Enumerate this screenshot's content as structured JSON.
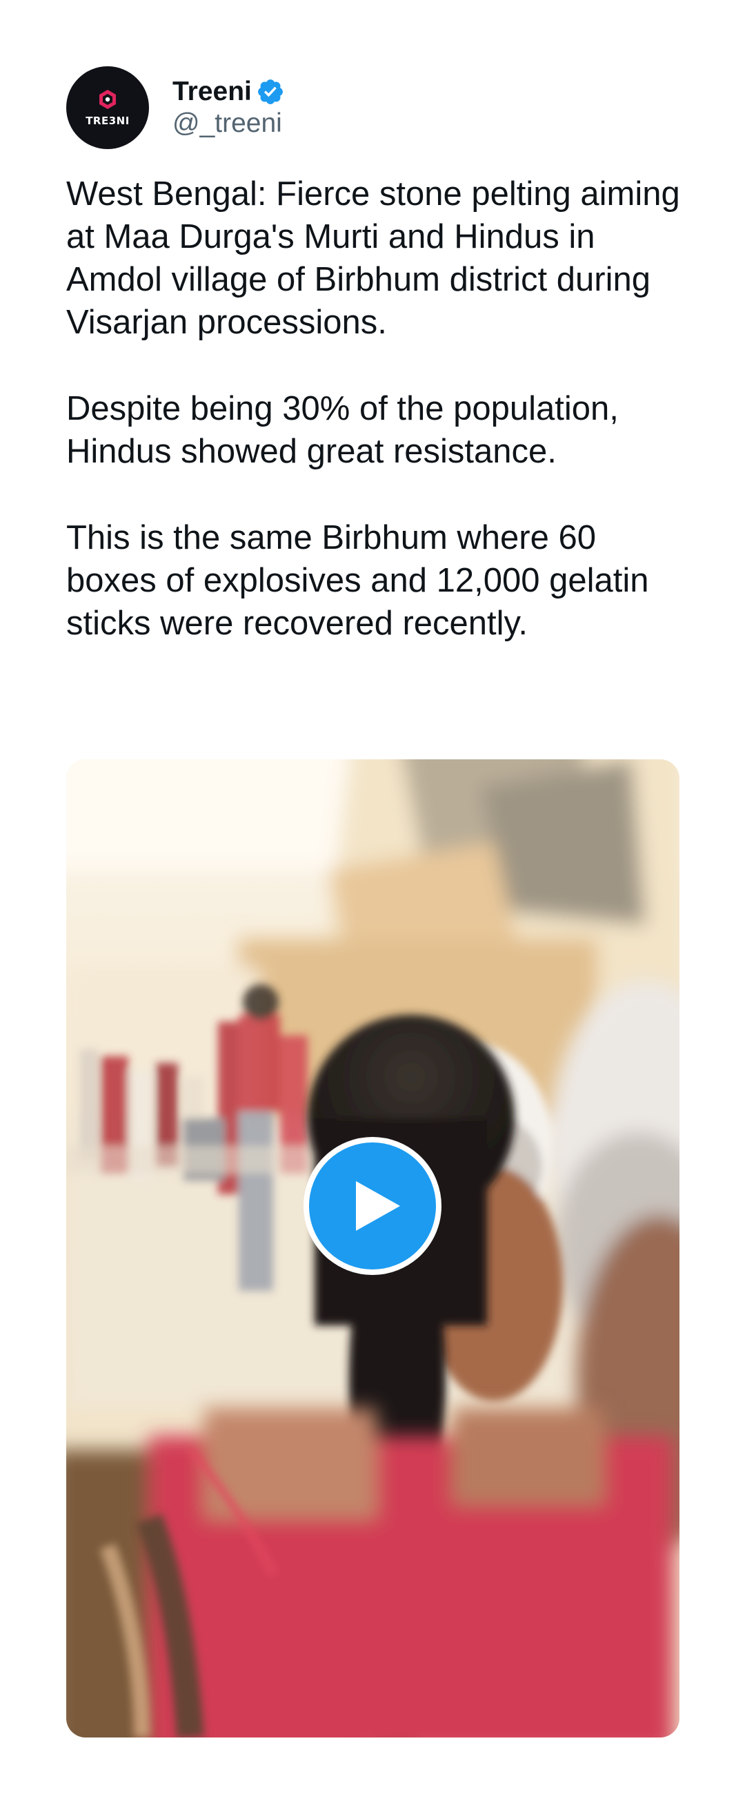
{
  "user": {
    "display_name": "Treeni",
    "handle": "@_treeni",
    "avatar_text": "TRE3NI",
    "verified": true
  },
  "tweet": {
    "paragraphs": [
      "West Bengal: Fierce stone pelting aiming at Maa Durga's Murti and Hindus in Amdol village of Birbhum district during Visarjan processions.",
      "Despite being 30% of the population, Hindus showed great resistance.",
      "This is the same Birbhum where 60 boxes of explosives and 12,000 gelatin sticks were recovered recently."
    ]
  },
  "media": {
    "type": "video",
    "play_icon": "play-icon"
  },
  "colors": {
    "accent": "#1d9bf0",
    "text": "#0f1419",
    "secondary_text": "#536471",
    "avatar_bg": "#0f1116",
    "avatar_accent": "#e0245e"
  }
}
